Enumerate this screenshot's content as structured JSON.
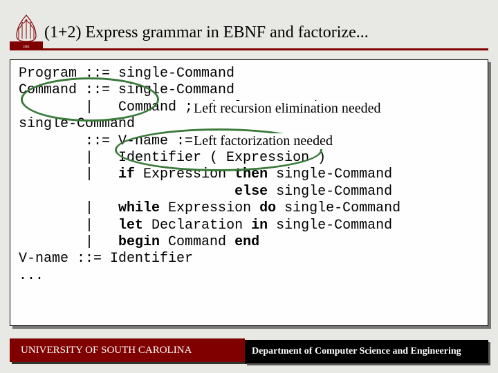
{
  "title": "(1+2)  Express grammar in EBNF and factorize...",
  "annotation1": "Left recursion elimination needed",
  "annotation2": "Left factorization needed",
  "footer": {
    "left": "UNIVERSITY OF SOUTH CAROLINA",
    "right": "Department of Computer Science and Engineering"
  },
  "code": {
    "l1a": "Program ::= single-Command",
    "l2a": "Command ::= single-Command",
    "l3a": "        |   Command ; single-Command",
    "l4a": "single-Command",
    "l5a": "        ::= V-name := Expression",
    "l6a": "        |   Identifier ( Expression )",
    "l7a": "        |   ",
    "l7if": "if",
    "l7b": " Expression ",
    "l7then": "then",
    "l7c": " single-Command",
    "l8a": "                          ",
    "l8else": "else",
    "l8b": " single-Command",
    "l9a": "        |   ",
    "l9while": "while",
    "l9b": " Expression ",
    "l9do": "do",
    "l9c": " single-Command",
    "l10a": "        |   ",
    "l10let": "let",
    "l10b": " Declaration ",
    "l10in": "in",
    "l10c": " single-Command",
    "l11a": "        |   ",
    "l11begin": "begin",
    "l11b": " Command ",
    "l11end": "end",
    "l12a": "V-name ::= Identifier",
    "l13a": "..."
  }
}
